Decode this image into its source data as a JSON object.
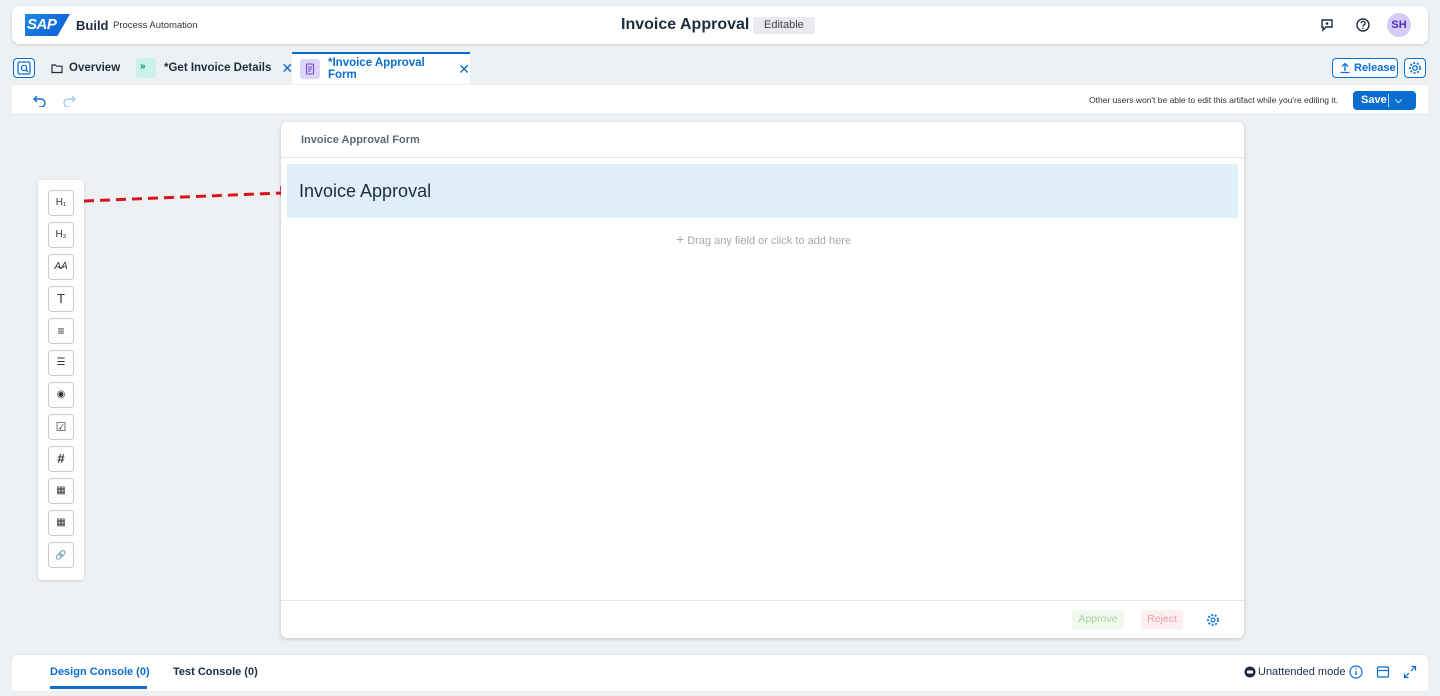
{
  "shell": {
    "logo": "SAP",
    "brand": "Build",
    "brand_sub": "Process Automation",
    "title": "Invoice Approval",
    "status_badge": "Editable",
    "avatar_initials": "SH",
    "accent": "#0a6ed1"
  },
  "tabs": [
    {
      "label": "Overview",
      "icon": "folder-icon"
    },
    {
      "label": "*Get Invoice Details",
      "icon": "automation-icon"
    },
    {
      "label": "*Invoice Approval Form",
      "icon": "form-icon",
      "active": true
    }
  ],
  "actions": {
    "release": "Release"
  },
  "toolbar": {
    "notice": "Other users won't be able to edit this artifact while you're editing it.",
    "save": "Save"
  },
  "palette": [
    {
      "name": "heading-1",
      "glyph": "H₁"
    },
    {
      "name": "heading-2",
      "glyph": "H₂"
    },
    {
      "name": "text-style",
      "glyph": "A̶A"
    },
    {
      "name": "text",
      "glyph": "T"
    },
    {
      "name": "paragraph",
      "glyph": "≡"
    },
    {
      "name": "checklist",
      "glyph": "☰"
    },
    {
      "name": "radio",
      "glyph": "◉"
    },
    {
      "name": "checkbox",
      "glyph": "☑"
    },
    {
      "name": "number",
      "glyph": "#"
    },
    {
      "name": "date",
      "glyph": "▦"
    },
    {
      "name": "table",
      "glyph": "▦"
    },
    {
      "name": "link",
      "glyph": "🔗"
    }
  ],
  "form": {
    "name": "Invoice Approval Form",
    "heading": "Invoice Approval",
    "drop_hint": "Drag any field or click to add here",
    "approve": "Approve",
    "reject": "Reject"
  },
  "console": {
    "design": "Design Console (0)",
    "test": "Test Console (0)",
    "mode": "Unattended mode"
  }
}
